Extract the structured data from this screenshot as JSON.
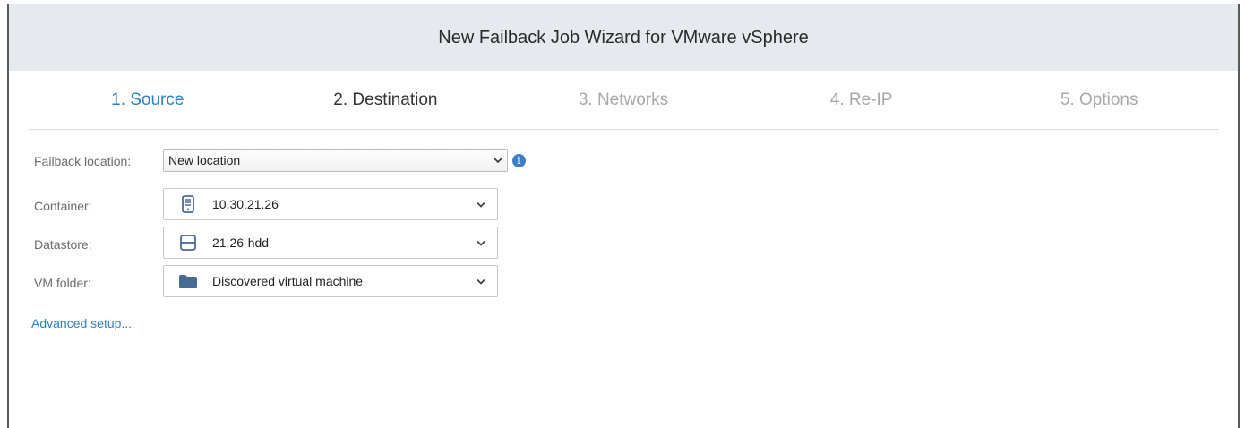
{
  "window": {
    "title": "New Failback Job Wizard for VMware vSphere"
  },
  "steps": [
    {
      "label": "1. Source",
      "state": "completed"
    },
    {
      "label": "2. Destination",
      "state": "current"
    },
    {
      "label": "3. Networks",
      "state": "pending"
    },
    {
      "label": "4. Re-IP",
      "state": "pending"
    },
    {
      "label": "5. Options",
      "state": "pending"
    }
  ],
  "form": {
    "failback_location": {
      "label": "Failback location:",
      "value": "New location",
      "info_icon": "info-icon"
    },
    "container": {
      "label": "Container:",
      "value": "10.30.21.26",
      "icon": "host-server-icon"
    },
    "datastore": {
      "label": "Datastore:",
      "value": "21.26-hdd",
      "icon": "datastore-icon"
    },
    "vm_folder": {
      "label": "VM folder:",
      "value": "Discovered virtual machine",
      "icon": "folder-icon"
    }
  },
  "advanced_link": "Advanced setup...",
  "colors": {
    "accent": "#2f7fc7",
    "titlebar_bg": "#e6e9ee",
    "icon": "#4a6a96"
  }
}
